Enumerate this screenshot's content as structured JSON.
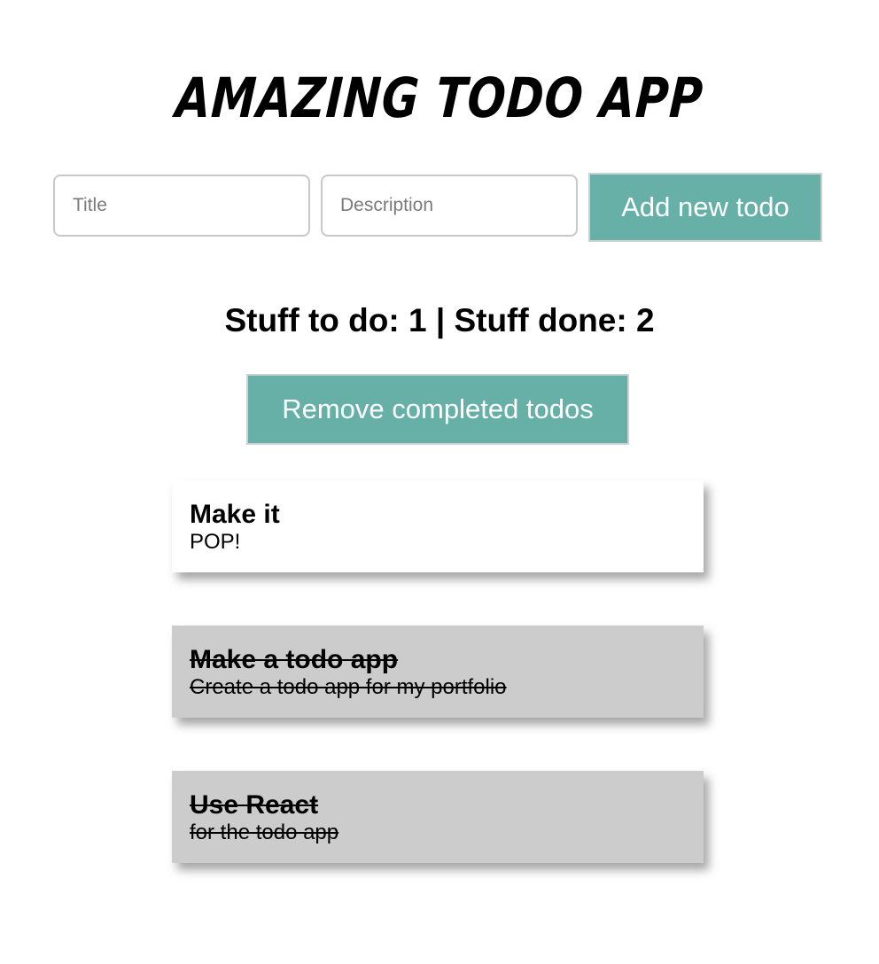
{
  "app": {
    "title": "Amazing Todo App"
  },
  "form": {
    "title_placeholder": "Title",
    "title_value": "",
    "description_placeholder": "Description",
    "description_value": "",
    "add_label": "Add new todo"
  },
  "counter": {
    "text": "Stuff to do: 1 | Stuff done: 2"
  },
  "actions": {
    "remove_completed_label": "Remove completed todos"
  },
  "colors": {
    "accent": "#66b0a8",
    "card_open": "#ffffff",
    "card_done": "#cccccc"
  },
  "todos": [
    {
      "title": "Make it",
      "description": "POP!",
      "done": false
    },
    {
      "title": "Make a todo app",
      "description": "Create a todo app for my portfolio",
      "done": true
    },
    {
      "title": "Use React",
      "description": "for the todo app",
      "done": true
    }
  ]
}
